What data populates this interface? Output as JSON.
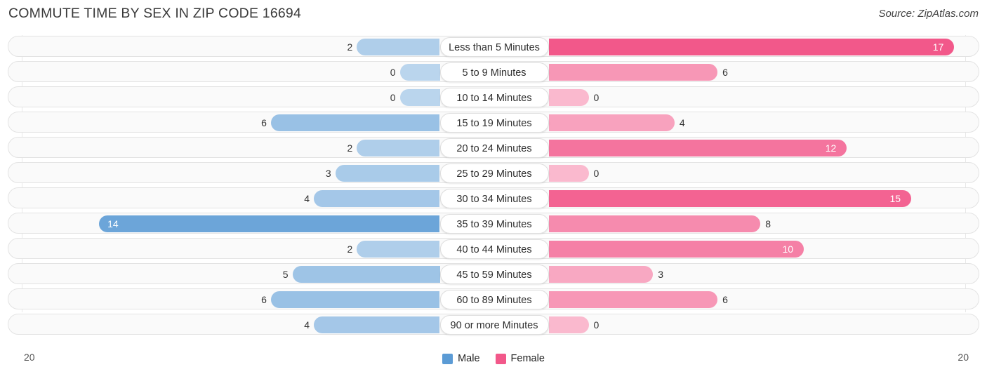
{
  "header": {
    "title": "COMMUTE TIME BY SEX IN ZIP CODE 16694",
    "source": "Source: ZipAtlas.com"
  },
  "axis": {
    "left_label": "20",
    "right_label": "20"
  },
  "legend": {
    "items": [
      {
        "label": "Male",
        "color": "#5b9bd5"
      },
      {
        "label": "Female",
        "color": "#f2588a"
      }
    ]
  },
  "chart_data": {
    "type": "bar",
    "orientation": "horizontal-diverging",
    "title": "COMMUTE TIME BY SEX IN ZIP CODE 16694",
    "xlabel": "",
    "ylabel": "",
    "xlim": [
      20,
      20
    ],
    "grid": true,
    "legend_position": "bottom-center",
    "categories": [
      "Less than 5 Minutes",
      "5 to 9 Minutes",
      "10 to 14 Minutes",
      "15 to 19 Minutes",
      "20 to 24 Minutes",
      "25 to 29 Minutes",
      "30 to 34 Minutes",
      "35 to 39 Minutes",
      "40 to 44 Minutes",
      "45 to 59 Minutes",
      "60 to 89 Minutes",
      "90 or more Minutes"
    ],
    "series": [
      {
        "name": "Male",
        "side": "left",
        "color": "#5b9bd5",
        "values": [
          2,
          0,
          0,
          6,
          2,
          3,
          4,
          14,
          2,
          5,
          6,
          4
        ]
      },
      {
        "name": "Female",
        "side": "right",
        "color": "#f2588a",
        "values": [
          17,
          6,
          0,
          4,
          12,
          0,
          15,
          8,
          10,
          3,
          6,
          0
        ]
      }
    ]
  }
}
